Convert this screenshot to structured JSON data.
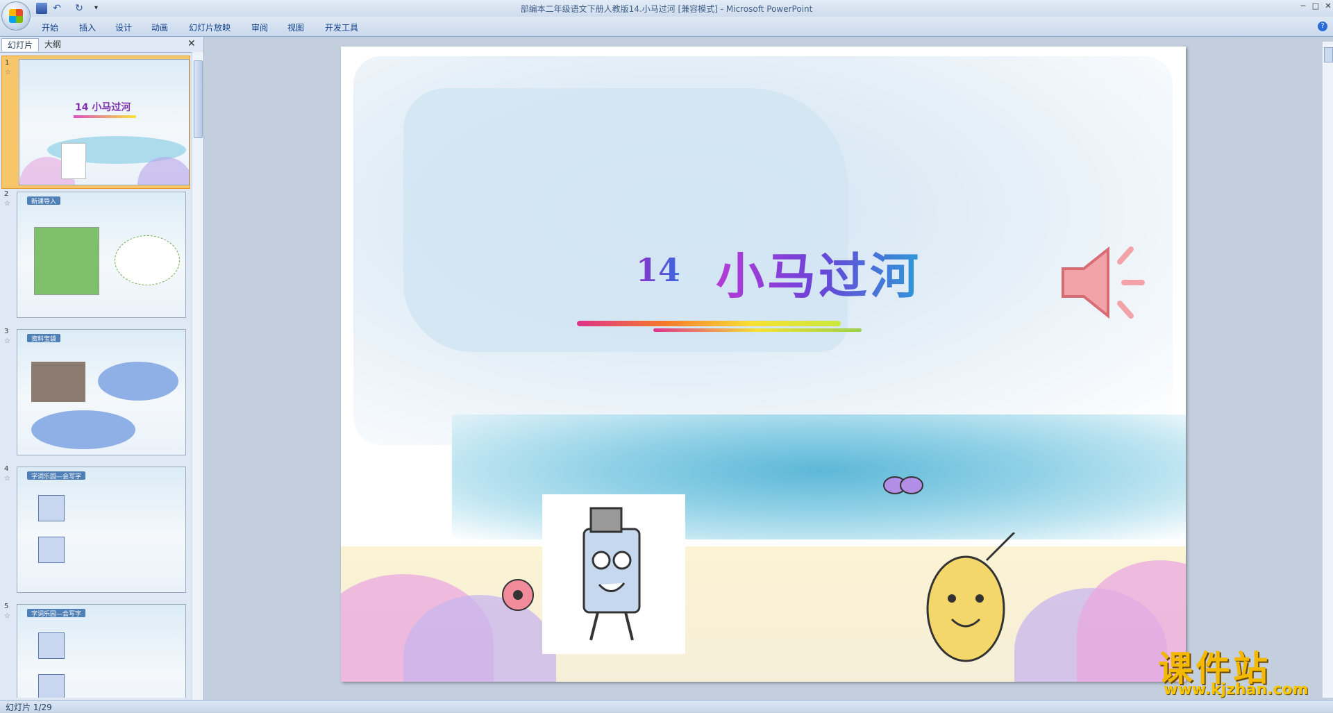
{
  "window": {
    "title": "部编本二年级语文下册人教版14.小马过河 [兼容模式] - Microsoft PowerPoint",
    "minimize": "−",
    "maximize": "□",
    "close": "✕"
  },
  "quick_access": {
    "undo": "↶",
    "redo": "↻",
    "more": "▾"
  },
  "ribbon": {
    "tabs": [
      "开始",
      "插入",
      "设计",
      "动画",
      "幻灯片放映",
      "审阅",
      "视图",
      "开发工具"
    ],
    "help": "?"
  },
  "left_pane": {
    "tabs": [
      "幻灯片",
      "大纲"
    ],
    "close": "✕",
    "thumbnails": [
      {
        "num": "1",
        "header": "",
        "title": "14 小马过河"
      },
      {
        "num": "2",
        "header": "新课导入",
        "title": ""
      },
      {
        "num": "3",
        "header": "资料宝袋",
        "title": ""
      },
      {
        "num": "4",
        "header": "字词乐园—会写字",
        "title": ""
      },
      {
        "num": "5",
        "header": "字词乐园—会写字",
        "title": ""
      }
    ]
  },
  "slide": {
    "number": "14",
    "title": "小马过河"
  },
  "watermark": {
    "main": "课件站",
    "url": "www.kjzhan.com"
  },
  "status": {
    "text": "幻灯片 1/29"
  },
  "colors": {
    "ribbon_bg": "#dfe9f5",
    "accent": "#15428b",
    "workspace": "#c3cfdd"
  }
}
